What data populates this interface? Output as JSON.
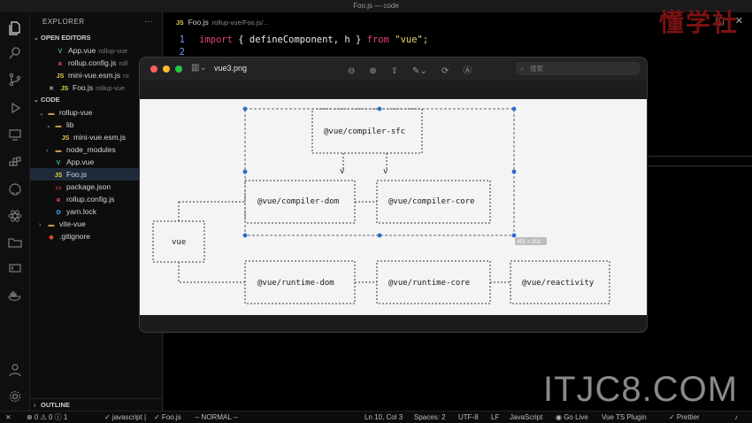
{
  "window_title": "Foo.js — code",
  "sidebar": {
    "title": "EXPLORER",
    "more": "···",
    "open_editors_label": "OPEN EDITORS",
    "open_editors": [
      {
        "icon": "V",
        "name": "App.vue",
        "path": "rollup-vue"
      },
      {
        "icon": "R",
        "name": "rollup.config.js",
        "path": "roll"
      },
      {
        "icon": "JS",
        "name": "mini-vue.esm.js",
        "path": "ro"
      },
      {
        "icon": "JS",
        "name": "Foo.js",
        "path": "rollup-vue"
      }
    ],
    "code_label": "CODE",
    "tree": [
      {
        "name": "rollup-vue"
      },
      {
        "name": "lib"
      },
      {
        "name": "mini-vue.esm.js"
      },
      {
        "name": "node_modules"
      },
      {
        "name": "App.vue"
      },
      {
        "name": "Foo.js"
      },
      {
        "name": "package.json"
      },
      {
        "name": "rollup.config.js"
      },
      {
        "name": "yarn.lock"
      },
      {
        "name": "vite-vue"
      },
      {
        "name": ".gitignore"
      }
    ],
    "outline_label": "OUTLINE"
  },
  "editor": {
    "tab_file": "Foo.js",
    "tab_path": "rollup-vue/Foo.js/...",
    "lines": [
      {
        "num": "1",
        "kw1": "import",
        "mid": " { defineComponent, h } ",
        "kw2": "from",
        "str": " \"vue\";"
      },
      {
        "num": "2"
      }
    ]
  },
  "preview": {
    "title": "vue3.png",
    "search_placeholder": "搜索",
    "selection_size": "455 × 219",
    "diagram": {
      "compiler_sfc": "@vue/compiler-sfc",
      "compiler_dom": "@vue/compiler-dom",
      "compiler_core": "@vue/compiler-core",
      "vue": "vue",
      "runtime_dom": "@vue/runtime-dom",
      "runtime_core": "@vue/runtime-core",
      "reactivity": "@vue/reactivity",
      "arrow_down": "v",
      "arrow_right": "--->",
      "arrow_left_start": "+----------->",
      "arrow_left_end": "+----------->"
    }
  },
  "watermarks": {
    "brand_cn": "懂学社",
    "site": "ITJC8.COM"
  },
  "statusbar": {
    "remote": "⨯",
    "problems": "⊗ 0 ⚠ 0 ⓘ 1",
    "lang_check": "✓ javascript |",
    "file_check": "✓ Foo.js",
    "mode": "-- NORMAL --",
    "position": "Ln 10, Col 3",
    "spaces": "Spaces: 2",
    "encoding": "UTF-8",
    "eol": "LF",
    "language": "JavaScript",
    "golive": "Go Live",
    "plugin": "Vue TS Plugin",
    "prettier": "✓ Prettier",
    "bell": "🔔"
  }
}
